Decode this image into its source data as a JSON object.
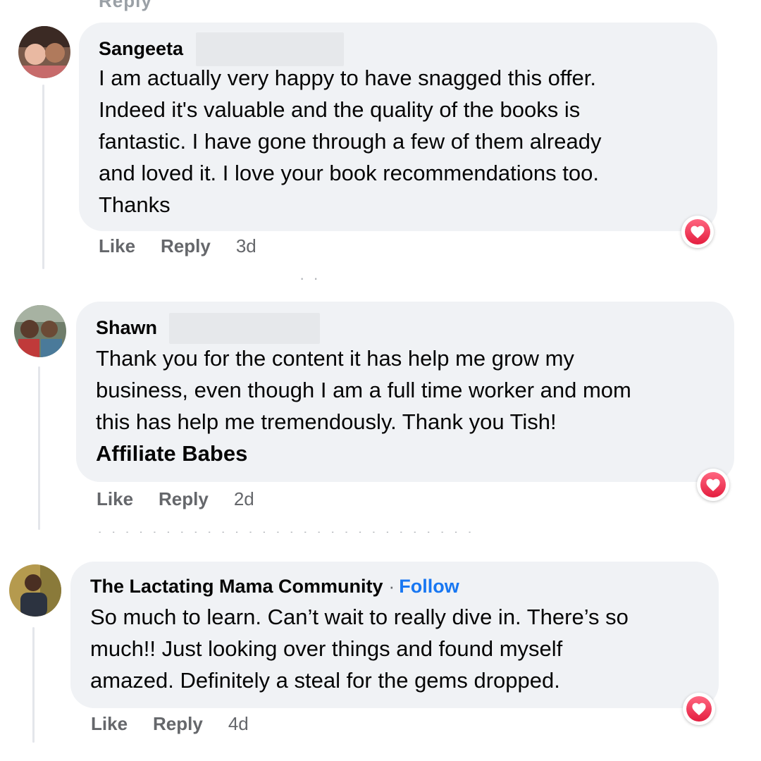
{
  "colors": {
    "bubble_bg": "#f0f2f5",
    "secondary_text": "#65676b",
    "follow_link": "#1877f2",
    "reaction_heart": "#e41e3f"
  },
  "top_clipped_text": "Reply",
  "comments": [
    {
      "author": "Sangeeta",
      "follow_label": "",
      "lines": [
        "I am actually very happy to have snagged this offer.",
        "Indeed it's valuable and the quality of the books is",
        "fantastic. I have gone through a few of them already",
        "and loved it. I love your book recommendations too.",
        "Thanks"
      ],
      "tag": "",
      "actions": {
        "like": "Like",
        "reply": "Reply",
        "time": "3d"
      },
      "reaction_icon": "heart-icon"
    },
    {
      "author": "Shawn",
      "follow_label": "",
      "lines": [
        "Thank you for the content it has help me grow my",
        "business, even though I am a full time worker and mom",
        "this has help me tremendously. Thank you Tish!"
      ],
      "tag": "Affiliate Babes",
      "actions": {
        "like": "Like",
        "reply": "Reply",
        "time": "2d"
      },
      "reaction_icon": "heart-icon"
    },
    {
      "author": "The Lactating Mama Community",
      "separator": "·",
      "follow_label": "Follow",
      "lines": [
        "So much to learn. Can’t wait to really dive in. There’s so",
        "much!! Just looking over things and found myself",
        "amazed. Definitely a steal for the gems dropped."
      ],
      "tag": "",
      "actions": {
        "like": "Like",
        "reply": "Reply",
        "time": "4d"
      },
      "reaction_icon": "heart-icon"
    }
  ]
}
